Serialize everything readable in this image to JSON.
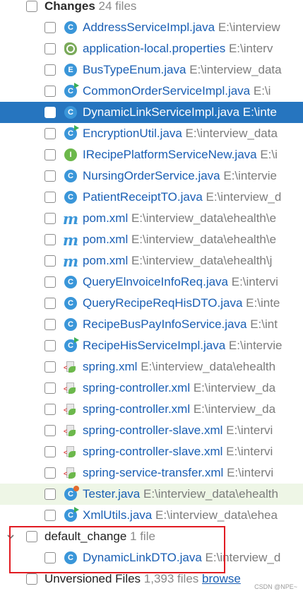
{
  "changelist_changes": {
    "title": "Changes",
    "count": "24 files",
    "files": [
      {
        "name": "AddressServiceImpl.java",
        "path": "E:\\interview",
        "icon": "class-icon",
        "type": "class"
      },
      {
        "name": "application-local.properties",
        "path": "E:\\interv",
        "icon": "properties-file-icon",
        "type": "props"
      },
      {
        "name": "BusTypeEnum.java",
        "path": "E:\\interview_data",
        "icon": "enum-icon",
        "type": "enum"
      },
      {
        "name": "CommonOrderServiceImpl.java",
        "path": "E:\\i",
        "icon": "runnable-class-icon",
        "type": "run"
      },
      {
        "name": "DynamicLinkServiceImpl.java",
        "path": "E:\\inte",
        "icon": "class-icon",
        "type": "class",
        "selected": true
      },
      {
        "name": "EncryptionUtil.java",
        "path": "E:\\interview_data",
        "icon": "runnable-class-icon",
        "type": "run"
      },
      {
        "name": "IRecipePlatformServiceNew.java",
        "path": "E:\\i",
        "icon": "interface-icon",
        "type": "iface"
      },
      {
        "name": "NursingOrderService.java",
        "path": "E:\\intervie",
        "icon": "class-icon",
        "type": "class"
      },
      {
        "name": "PatientReceiptTO.java",
        "path": "E:\\interview_d",
        "icon": "class-icon",
        "type": "class"
      },
      {
        "name": "pom.xml",
        "path": "E:\\interview_data\\ehealth\\e",
        "icon": "maven-icon",
        "type": "maven"
      },
      {
        "name": "pom.xml",
        "path": "E:\\interview_data\\ehealth\\e",
        "icon": "maven-icon",
        "type": "maven"
      },
      {
        "name": "pom.xml",
        "path": "E:\\interview_data\\ehealth\\j",
        "icon": "maven-icon",
        "type": "maven"
      },
      {
        "name": "QueryElnvoiceInfoReq.java",
        "path": "E:\\intervi",
        "icon": "class-icon",
        "type": "class"
      },
      {
        "name": "QueryRecipeReqHisDTO.java",
        "path": "E:\\inte",
        "icon": "class-icon",
        "type": "class"
      },
      {
        "name": "RecipeBusPayInfoService.java",
        "path": "E:\\int",
        "icon": "class-icon",
        "type": "class"
      },
      {
        "name": "RecipeHisServiceImpl.java",
        "path": "E:\\intervie",
        "icon": "runnable-class-icon",
        "type": "run"
      },
      {
        "name": "spring.xml",
        "path": "E:\\interview_data\\ehealth",
        "icon": "xml-file-icon",
        "type": "xml"
      },
      {
        "name": "spring-controller.xml",
        "path": "E:\\interview_da",
        "icon": "xml-file-icon",
        "type": "xml"
      },
      {
        "name": "spring-controller.xml",
        "path": "E:\\interview_da",
        "icon": "xml-file-icon",
        "type": "xml"
      },
      {
        "name": "spring-controller-slave.xml",
        "path": "E:\\intervi",
        "icon": "xml-file-icon",
        "type": "xml"
      },
      {
        "name": "spring-controller-slave.xml",
        "path": "E:\\intervi",
        "icon": "xml-file-icon",
        "type": "xml"
      },
      {
        "name": "spring-service-transfer.xml",
        "path": "E:\\intervi",
        "icon": "xml-file-icon",
        "type": "xml"
      },
      {
        "name": "Tester.java",
        "path": "E:\\interview_data\\ehealth",
        "icon": "test-class-icon",
        "type": "test",
        "highlight": true
      },
      {
        "name": "XmlUtils.java",
        "path": "E:\\interview_data\\ehea",
        "icon": "runnable-class-icon",
        "type": "run"
      }
    ]
  },
  "changelist_default": {
    "title": "default_change",
    "count": "1 file",
    "files": [
      {
        "name": "DynamicLinkDTO.java",
        "path": "E:\\interview_d",
        "icon": "class-icon",
        "type": "class"
      }
    ]
  },
  "unversioned": {
    "title": "Unversioned Files",
    "count": "1,393 files",
    "link": "browse"
  },
  "watermark": "CSDN @NPE~",
  "colors": {
    "selection": "#2675bf",
    "link": "#1a5fb4",
    "annotation_box": "#e11b22"
  }
}
